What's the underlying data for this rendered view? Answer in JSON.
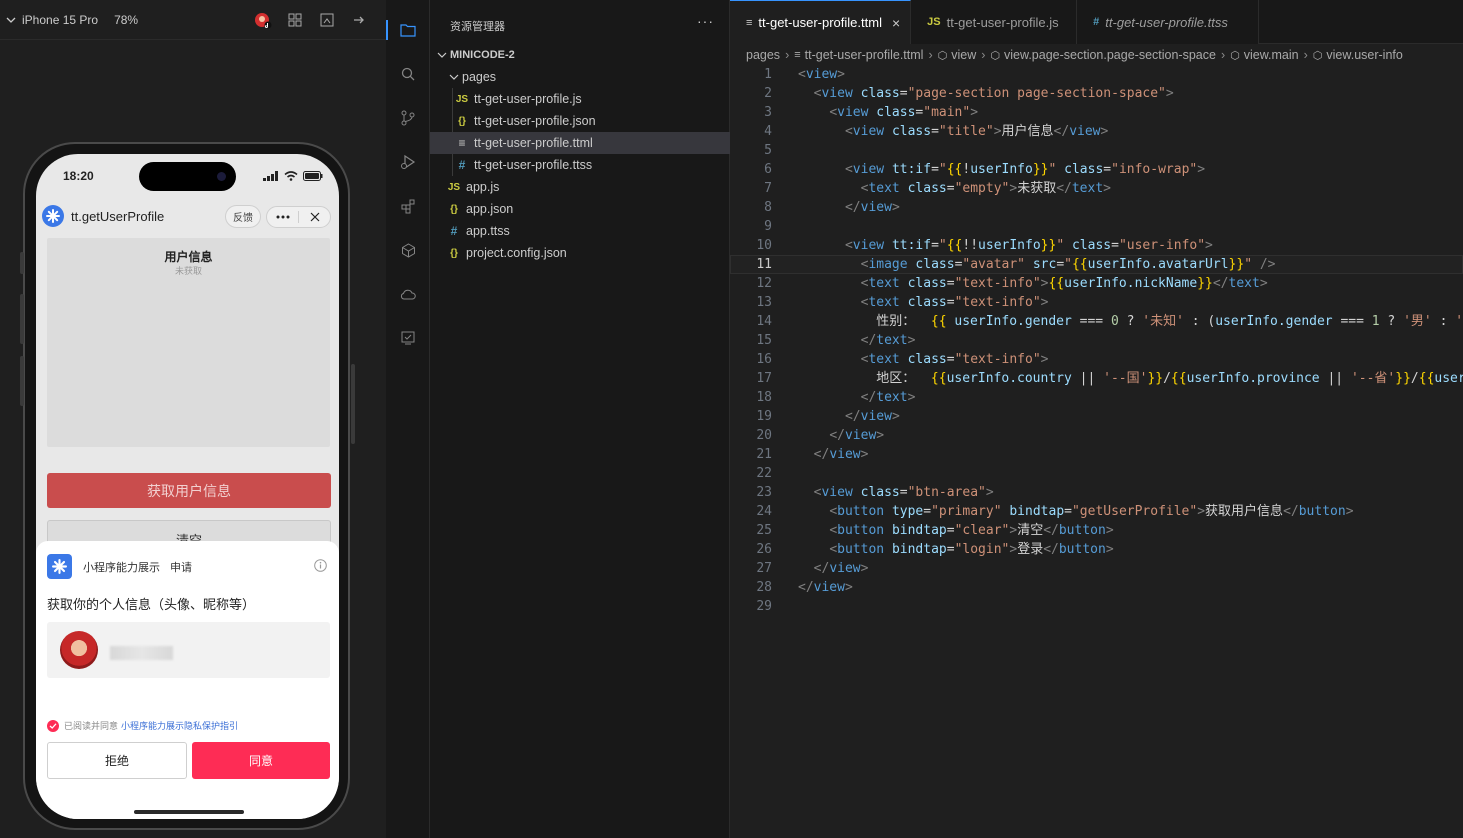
{
  "simulator": {
    "device": "iPhone 15 Pro",
    "zoom": "78%",
    "status_time": "18:20",
    "nav_title": "tt.getUserProfile",
    "feedback": "反馈",
    "page_title": "用户信息",
    "page_empty": "未获取",
    "btn_get_profile": "获取用户信息",
    "btn_clear": "清空",
    "sheet": {
      "app_name": "小程序能力展示",
      "request_label": "申请",
      "description": "获取你的个人信息（头像、昵称等）",
      "agree_prefix": "已阅读并同意",
      "agree_link": "小程序能力展示隐私保护指引",
      "deny_label": "拒绝",
      "allow_label": "同意"
    }
  },
  "activity_bar": [
    "explorer-icon",
    "search-icon",
    "source-control-icon",
    "run-debug-icon",
    "extensions-icon",
    "package-icon",
    "cloud-icon",
    "preview-icon"
  ],
  "explorer": {
    "title": "资源管理器",
    "more": "···",
    "project": "MINICODE-2",
    "folder": "pages",
    "files": [
      {
        "name": "tt-get-user-profile.js",
        "icon": "JS",
        "kind": "js"
      },
      {
        "name": "tt-get-user-profile.json",
        "icon": "{}",
        "kind": "json"
      },
      {
        "name": "tt-get-user-profile.ttml",
        "icon": "≡",
        "kind": "ttml"
      },
      {
        "name": "tt-get-user-profile.ttss",
        "icon": "#",
        "kind": "ttss"
      }
    ],
    "root_files": [
      {
        "name": "app.js",
        "icon": "JS",
        "kind": "js"
      },
      {
        "name": "app.json",
        "icon": "{}",
        "kind": "json"
      },
      {
        "name": "app.ttss",
        "icon": "#",
        "kind": "ttss"
      },
      {
        "name": "project.config.json",
        "icon": "{}",
        "kind": "json"
      }
    ]
  },
  "editor": {
    "tabs": [
      {
        "label": "tt-get-user-profile.ttml",
        "icon": "≡",
        "active": true,
        "close": "×"
      },
      {
        "label": "tt-get-user-profile.js",
        "icon": "JS",
        "active": false
      },
      {
        "label": "tt-get-user-profile.ttss",
        "icon": "#",
        "active": false
      }
    ],
    "breadcrumbs": [
      "pages",
      "tt-get-user-profile.ttml",
      "view",
      "view.page-section.page-section-space",
      "view.main",
      "view.user-info"
    ],
    "current_line": 11,
    "lines": [
      [
        [
          "t-punc",
          "<"
        ],
        [
          "t-tag",
          "view"
        ],
        [
          "t-punc",
          ">"
        ]
      ],
      [
        [
          "t-text",
          "  "
        ],
        [
          "t-punc",
          "<"
        ],
        [
          "t-tag",
          "view"
        ],
        [
          "t-text",
          " "
        ],
        [
          "t-attr",
          "class"
        ],
        [
          "t-text",
          "="
        ],
        [
          "t-str",
          "\"page-section page-section-space\""
        ],
        [
          "t-punc",
          ">"
        ]
      ],
      [
        [
          "t-text",
          "    "
        ],
        [
          "t-punc",
          "<"
        ],
        [
          "t-tag",
          "view"
        ],
        [
          "t-text",
          " "
        ],
        [
          "t-attr",
          "class"
        ],
        [
          "t-text",
          "="
        ],
        [
          "t-str",
          "\"main\""
        ],
        [
          "t-punc",
          ">"
        ]
      ],
      [
        [
          "t-text",
          "      "
        ],
        [
          "t-punc",
          "<"
        ],
        [
          "t-tag",
          "view"
        ],
        [
          "t-text",
          " "
        ],
        [
          "t-attr",
          "class"
        ],
        [
          "t-text",
          "="
        ],
        [
          "t-str",
          "\"title\""
        ],
        [
          "t-punc",
          ">"
        ],
        [
          "t-text",
          "用户信息"
        ],
        [
          "t-punc",
          "</"
        ],
        [
          "t-tag",
          "view"
        ],
        [
          "t-punc",
          ">"
        ]
      ],
      [],
      [
        [
          "t-text",
          "      "
        ],
        [
          "t-punc",
          "<"
        ],
        [
          "t-tag",
          "view"
        ],
        [
          "t-text",
          " "
        ],
        [
          "t-attr",
          "tt:if"
        ],
        [
          "t-text",
          "="
        ],
        [
          "t-str",
          "\""
        ],
        [
          "t-br",
          "{{"
        ],
        [
          "t-kw",
          "!"
        ],
        [
          "t-var",
          "userInfo"
        ],
        [
          "t-br",
          "}}"
        ],
        [
          "t-str",
          "\""
        ],
        [
          "t-text",
          " "
        ],
        [
          "t-attr",
          "class"
        ],
        [
          "t-text",
          "="
        ],
        [
          "t-str",
          "\"info-wrap\""
        ],
        [
          "t-punc",
          ">"
        ]
      ],
      [
        [
          "t-text",
          "        "
        ],
        [
          "t-punc",
          "<"
        ],
        [
          "t-tag",
          "text"
        ],
        [
          "t-text",
          " "
        ],
        [
          "t-attr",
          "class"
        ],
        [
          "t-text",
          "="
        ],
        [
          "t-str",
          "\"empty\""
        ],
        [
          "t-punc",
          ">"
        ],
        [
          "t-text",
          "未获取"
        ],
        [
          "t-punc",
          "</"
        ],
        [
          "t-tag",
          "text"
        ],
        [
          "t-punc",
          ">"
        ]
      ],
      [
        [
          "t-text",
          "      "
        ],
        [
          "t-punc",
          "</"
        ],
        [
          "t-tag",
          "view"
        ],
        [
          "t-punc",
          ">"
        ]
      ],
      [],
      [
        [
          "t-text",
          "      "
        ],
        [
          "t-punc",
          "<"
        ],
        [
          "t-tag",
          "view"
        ],
        [
          "t-text",
          " "
        ],
        [
          "t-attr",
          "tt:if"
        ],
        [
          "t-text",
          "="
        ],
        [
          "t-str",
          "\""
        ],
        [
          "t-br",
          "{{"
        ],
        [
          "t-kw",
          "!!"
        ],
        [
          "t-var",
          "userInfo"
        ],
        [
          "t-br",
          "}}"
        ],
        [
          "t-str",
          "\""
        ],
        [
          "t-text",
          " "
        ],
        [
          "t-attr",
          "class"
        ],
        [
          "t-text",
          "="
        ],
        [
          "t-str",
          "\"user-info\""
        ],
        [
          "t-punc",
          ">"
        ]
      ],
      [
        [
          "t-text",
          "        "
        ],
        [
          "t-punc",
          "<"
        ],
        [
          "t-tag",
          "image"
        ],
        [
          "t-text",
          " "
        ],
        [
          "t-attr",
          "class"
        ],
        [
          "t-text",
          "="
        ],
        [
          "t-str",
          "\"avatar\""
        ],
        [
          "t-text",
          " "
        ],
        [
          "t-attr",
          "src"
        ],
        [
          "t-text",
          "="
        ],
        [
          "t-str",
          "\""
        ],
        [
          "t-br",
          "{{"
        ],
        [
          "t-var",
          "userInfo.avatarUrl"
        ],
        [
          "t-br",
          "}}"
        ],
        [
          "t-str",
          "\""
        ],
        [
          "t-text",
          " "
        ],
        [
          "t-punc",
          "/>"
        ]
      ],
      [
        [
          "t-text",
          "        "
        ],
        [
          "t-punc",
          "<"
        ],
        [
          "t-tag",
          "text"
        ],
        [
          "t-text",
          " "
        ],
        [
          "t-attr",
          "class"
        ],
        [
          "t-text",
          "="
        ],
        [
          "t-str",
          "\"text-info\""
        ],
        [
          "t-punc",
          ">"
        ],
        [
          "t-br",
          "{{"
        ],
        [
          "t-var",
          "userInfo.nickName"
        ],
        [
          "t-br",
          "}}"
        ],
        [
          "t-punc",
          "</"
        ],
        [
          "t-tag",
          "text"
        ],
        [
          "t-punc",
          ">"
        ]
      ],
      [
        [
          "t-text",
          "        "
        ],
        [
          "t-punc",
          "<"
        ],
        [
          "t-tag",
          "text"
        ],
        [
          "t-text",
          " "
        ],
        [
          "t-attr",
          "class"
        ],
        [
          "t-text",
          "="
        ],
        [
          "t-str",
          "\"text-info\""
        ],
        [
          "t-punc",
          ">"
        ]
      ],
      [
        [
          "t-text",
          "          性别：  "
        ],
        [
          "t-br",
          "{{"
        ],
        [
          "t-text",
          " "
        ],
        [
          "t-var",
          "userInfo.gender"
        ],
        [
          "t-text",
          " === "
        ],
        [
          "t-num",
          "0"
        ],
        [
          "t-text",
          " ? "
        ],
        [
          "t-str",
          "'未知'"
        ],
        [
          "t-text",
          " : ("
        ],
        [
          "t-var",
          "userInfo.gender"
        ],
        [
          "t-text",
          " === "
        ],
        [
          "t-num",
          "1"
        ],
        [
          "t-text",
          " ? "
        ],
        [
          "t-str",
          "'男'"
        ],
        [
          "t-text",
          " : "
        ],
        [
          "t-str",
          "'女'"
        ]
      ],
      [
        [
          "t-text",
          "        "
        ],
        [
          "t-punc",
          "</"
        ],
        [
          "t-tag",
          "text"
        ],
        [
          "t-punc",
          ">"
        ]
      ],
      [
        [
          "t-text",
          "        "
        ],
        [
          "t-punc",
          "<"
        ],
        [
          "t-tag",
          "text"
        ],
        [
          "t-text",
          " "
        ],
        [
          "t-attr",
          "class"
        ],
        [
          "t-text",
          "="
        ],
        [
          "t-str",
          "\"text-info\""
        ],
        [
          "t-punc",
          ">"
        ]
      ],
      [
        [
          "t-text",
          "          地区：  "
        ],
        [
          "t-br",
          "{{"
        ],
        [
          "t-var",
          "userInfo.country"
        ],
        [
          "t-text",
          " || "
        ],
        [
          "t-str",
          "'--国'"
        ],
        [
          "t-br",
          "}}"
        ],
        [
          "t-text",
          "/"
        ],
        [
          "t-br",
          "{{"
        ],
        [
          "t-var",
          "userInfo.province"
        ],
        [
          "t-text",
          " || "
        ],
        [
          "t-str",
          "'--省'"
        ],
        [
          "t-br",
          "}}"
        ],
        [
          "t-text",
          "/"
        ],
        [
          "t-br",
          "{{"
        ],
        [
          "t-var",
          "userInfo.city"
        ]
      ],
      [
        [
          "t-text",
          "        "
        ],
        [
          "t-punc",
          "</"
        ],
        [
          "t-tag",
          "text"
        ],
        [
          "t-punc",
          ">"
        ]
      ],
      [
        [
          "t-text",
          "      "
        ],
        [
          "t-punc",
          "</"
        ],
        [
          "t-tag",
          "view"
        ],
        [
          "t-punc",
          ">"
        ]
      ],
      [
        [
          "t-text",
          "    "
        ],
        [
          "t-punc",
          "</"
        ],
        [
          "t-tag",
          "view"
        ],
        [
          "t-punc",
          ">"
        ]
      ],
      [
        [
          "t-text",
          "  "
        ],
        [
          "t-punc",
          "</"
        ],
        [
          "t-tag",
          "view"
        ],
        [
          "t-punc",
          ">"
        ]
      ],
      [],
      [
        [
          "t-text",
          "  "
        ],
        [
          "t-punc",
          "<"
        ],
        [
          "t-tag",
          "view"
        ],
        [
          "t-text",
          " "
        ],
        [
          "t-attr",
          "class"
        ],
        [
          "t-text",
          "="
        ],
        [
          "t-str",
          "\"btn-area\""
        ],
        [
          "t-punc",
          ">"
        ]
      ],
      [
        [
          "t-text",
          "    "
        ],
        [
          "t-punc",
          "<"
        ],
        [
          "t-tag",
          "button"
        ],
        [
          "t-text",
          " "
        ],
        [
          "t-attr",
          "type"
        ],
        [
          "t-text",
          "="
        ],
        [
          "t-str",
          "\"primary\""
        ],
        [
          "t-text",
          " "
        ],
        [
          "t-attr",
          "bindtap"
        ],
        [
          "t-text",
          "="
        ],
        [
          "t-str",
          "\"getUserProfile\""
        ],
        [
          "t-punc",
          ">"
        ],
        [
          "t-text",
          "获取用户信息"
        ],
        [
          "t-punc",
          "</"
        ],
        [
          "t-tag",
          "button"
        ],
        [
          "t-punc",
          ">"
        ]
      ],
      [
        [
          "t-text",
          "    "
        ],
        [
          "t-punc",
          "<"
        ],
        [
          "t-tag",
          "button"
        ],
        [
          "t-text",
          " "
        ],
        [
          "t-attr",
          "bindtap"
        ],
        [
          "t-text",
          "="
        ],
        [
          "t-str",
          "\"clear\""
        ],
        [
          "t-punc",
          ">"
        ],
        [
          "t-text",
          "清空"
        ],
        [
          "t-punc",
          "</"
        ],
        [
          "t-tag",
          "button"
        ],
        [
          "t-punc",
          ">"
        ]
      ],
      [
        [
          "t-text",
          "    "
        ],
        [
          "t-punc",
          "<"
        ],
        [
          "t-tag",
          "button"
        ],
        [
          "t-text",
          " "
        ],
        [
          "t-attr",
          "bindtap"
        ],
        [
          "t-text",
          "="
        ],
        [
          "t-str",
          "\"login\""
        ],
        [
          "t-punc",
          ">"
        ],
        [
          "t-text",
          "登录"
        ],
        [
          "t-punc",
          "</"
        ],
        [
          "t-tag",
          "button"
        ],
        [
          "t-punc",
          ">"
        ]
      ],
      [
        [
          "t-text",
          "  "
        ],
        [
          "t-punc",
          "</"
        ],
        [
          "t-tag",
          "view"
        ],
        [
          "t-punc",
          ">"
        ]
      ],
      [
        [
          "t-punc",
          "</"
        ],
        [
          "t-tag",
          "view"
        ],
        [
          "t-punc",
          ">"
        ]
      ],
      []
    ]
  }
}
